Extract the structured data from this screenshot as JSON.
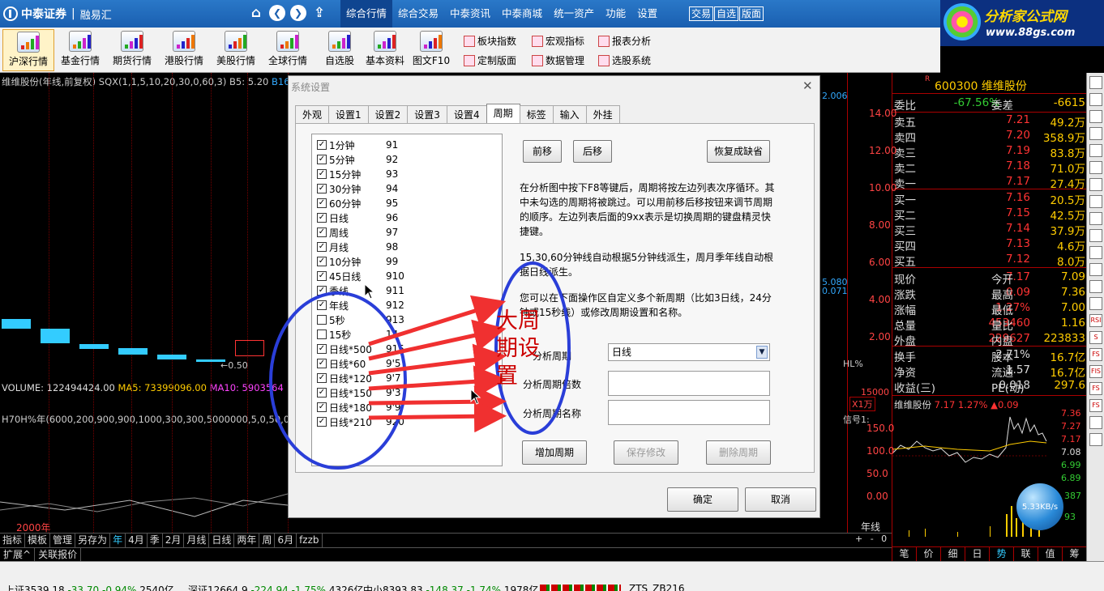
{
  "topbar": {
    "logo": "中泰证券",
    "sub": "融易汇",
    "nav_icons": [
      "home-icon",
      "back-icon",
      "forward-icon",
      "upload-icon"
    ],
    "menu": [
      "综合行情",
      "综合交易",
      "中泰资讯",
      "中泰商城",
      "统一资产",
      "功能",
      "设置"
    ],
    "active_menu": "综合行情",
    "quick": [
      "交易",
      "自选",
      "版面"
    ]
  },
  "brand": {
    "title": "分析家公式网",
    "url": "www.88gs.com"
  },
  "toolbar": {
    "buttons": [
      "沪深行情",
      "基金行情",
      "期货行情",
      "港股行情",
      "美股行情",
      "全球行情",
      "自选股",
      "基本资料",
      "图文F10"
    ],
    "links": [
      "板块指数",
      "宏观指标",
      "报表分析",
      "定制版面",
      "数据管理",
      "选股系统"
    ]
  },
  "chart": {
    "title": "维维股份(年线,前复权) SQX(1,1,5,10,20,30,0,60,3) B5: 5.20",
    "title_tail": "B16",
    "price_axis": [
      "14.00",
      "12.00",
      "10.00",
      "8.00",
      "6.00",
      "4.00",
      "2.00"
    ],
    "volume_line": {
      "vol": "VOLUME: 122494424.00",
      "ma5": "MA5: 73399096.00",
      "ma10": "MA10: 5903564"
    },
    "indicator_line": "H70H%年(6000,200,900,900,1000,300,300,5000000,5,0,50,0,1",
    "indicator_axis": [
      "150.0",
      "100.0",
      "50.0",
      "0.00"
    ],
    "marker_050": "←0.50",
    "year": "2000年",
    "hl": "HL%",
    "x1w": "X1万",
    "v15000": "15000",
    "v5080": "5.080",
    "v0071": "0.071",
    "v2006": "2.006",
    "xinhao": "信号1:"
  },
  "period_tabs": [
    "指标",
    "模板",
    "管理",
    "另存为",
    "年",
    "4月",
    "季",
    "2月",
    "月线",
    "日线",
    "两年",
    "周",
    "6月",
    "fzzb"
  ],
  "period_sel": "年",
  "year_label": "年线",
  "zoom": "+ - 0",
  "ext_tabs": [
    "扩展^",
    "关联报价"
  ],
  "status": {
    "sh": {
      "name": "上证",
      "val": "3539.18",
      "chg": "-33.70",
      "pct": "-0.94%",
      "amt": "2540亿"
    },
    "sz": {
      "name": "深证",
      "val": "12664.9",
      "chg": "-224.94",
      "pct": "-1.75%",
      "amt": "4326亿"
    },
    "zx": {
      "name": "中小",
      "val": "8393.83",
      "chg": "-148.37",
      "pct": "-1.74%",
      "amt": "1978亿"
    },
    "ext": "ZTS_ZB216"
  },
  "quote": {
    "r": "R",
    "code": "600300 维维股份",
    "weibi_label": "委比",
    "weibi": "-67.56%",
    "weicha_label": "委差",
    "weicha": "-6615",
    "sells": [
      {
        "label": "卖五",
        "price": "7.21",
        "vol": "49.2万"
      },
      {
        "label": "卖四",
        "price": "7.20",
        "vol": "358.9万"
      },
      {
        "label": "卖三",
        "price": "7.19",
        "vol": "83.8万"
      },
      {
        "label": "卖二",
        "price": "7.18",
        "vol": "71.0万"
      },
      {
        "label": "卖一",
        "price": "7.17",
        "vol": "27.4万"
      }
    ],
    "buys": [
      {
        "label": "买一",
        "price": "7.16",
        "vol": "20.5万"
      },
      {
        "label": "买二",
        "price": "7.15",
        "vol": "42.5万"
      },
      {
        "label": "买三",
        "price": "7.14",
        "vol": "37.9万"
      },
      {
        "label": "买四",
        "price": "7.13",
        "vol": "4.6万"
      },
      {
        "label": "买五",
        "price": "7.12",
        "vol": "8.0万"
      }
    ],
    "stats": [
      {
        "l1": "现价",
        "v1": "7.17",
        "l2": "今开",
        "v2": "7.09"
      },
      {
        "l1": "涨跌",
        "v1": "0.09",
        "l2": "最高",
        "v2": "7.36"
      },
      {
        "l1": "涨幅",
        "v1": "1.27%",
        "l2": "最低",
        "v2": "7.00"
      },
      {
        "l1": "总量",
        "v1": "453460",
        "l2": "量比",
        "v2": "1.16"
      },
      {
        "l1": "外盘",
        "v1": "229627",
        "l2": "内盘",
        "v2": "223833"
      }
    ],
    "stats2": [
      {
        "l1": "换手",
        "v1": "2.71%",
        "l2": "股本",
        "v2": "16.7亿"
      },
      {
        "l1": "净资",
        "v1": "1.57",
        "l2": "流通",
        "v2": "16.7亿"
      },
      {
        "l1": "收益(三)",
        "v1": "0.018",
        "l2": "PE(动)",
        "v2": "297.6"
      }
    ],
    "mini_title": "维维股份",
    "mini_price": "7.17",
    "mini_pct": "1.27%",
    "mini_chg": "▲0.09",
    "mini_axis": [
      "7.36",
      "7.27",
      "7.17",
      "7.08",
      "6.99",
      "6.89"
    ],
    "mini_pcts": [
      "387",
      "93"
    ],
    "speed": "5.33KB/s",
    "tabs": [
      "笔",
      "价",
      "细",
      "日",
      "势",
      "联",
      "值",
      "筹"
    ],
    "tab_sel": "势"
  },
  "side_icons": [
    "RSI",
    "S",
    "FS",
    "FIS",
    "FS",
    "FS"
  ],
  "dialog": {
    "title": "系统设置",
    "tabs": [
      "外观",
      "设置1",
      "设置2",
      "设置3",
      "设置4",
      "周期",
      "标签",
      "输入",
      "外挂"
    ],
    "tab_sel": "周期",
    "periods": [
      {
        "name": "1分钟",
        "code": "91",
        "checked": true
      },
      {
        "name": "5分钟",
        "code": "92",
        "checked": true
      },
      {
        "name": "15分钟",
        "code": "93",
        "checked": true
      },
      {
        "name": "30分钟",
        "code": "94",
        "checked": true
      },
      {
        "name": "60分钟",
        "code": "95",
        "checked": true
      },
      {
        "name": "日线",
        "code": "96",
        "checked": true
      },
      {
        "name": "周线",
        "code": "97",
        "checked": true
      },
      {
        "name": "月线",
        "code": "98",
        "checked": true
      },
      {
        "name": "10分钟",
        "code": "99",
        "checked": true
      },
      {
        "name": "45日线",
        "code": "910",
        "checked": true
      },
      {
        "name": "季线",
        "code": "911",
        "checked": true
      },
      {
        "name": "年线",
        "code": "912",
        "checked": true
      },
      {
        "name": "5秒",
        "code": "913",
        "checked": false
      },
      {
        "name": "15秒",
        "code": "14",
        "checked": false
      },
      {
        "name": "日线*500",
        "code": "915",
        "checked": true
      },
      {
        "name": "日线*60",
        "code": "9'5",
        "checked": true
      },
      {
        "name": "日线*120",
        "code": "9'7",
        "checked": true
      },
      {
        "name": "日线*150",
        "code": "9'3",
        "checked": true
      },
      {
        "name": "日线*180",
        "code": "9'9",
        "checked": true
      },
      {
        "name": "日线*210",
        "code": "920",
        "checked": true
      }
    ],
    "btn_prev": "前移",
    "btn_next": "后移",
    "btn_restore": "恢复成缺省",
    "desc1": "在分析图中按下F8等键后，周期将按左边列表次序循环。其中未勾选的周期将被跳过。可以用前移后移按钮来调节周期的顺序。左边列表后面的9xx表示是切换周期的键盘精灵快捷键。",
    "desc2": "15,30,60分钟线自动根据5分钟线派生，周月季年线自动根据日线派生。",
    "desc3": "您可以在下面操作区自定义多个新周期（比如3日线，24分钟或15秒线）或修改周期设置和名称。",
    "f_base": "分析周期",
    "f_base_val": "日线",
    "f_mult": "分析周期倍数",
    "f_name": "分析周期名称",
    "btn_add": "增加周期",
    "btn_save": "保存修改",
    "btn_del": "删除周期",
    "btn_ok": "确定",
    "btn_cancel": "取消"
  },
  "annotation": {
    "text": "大周期设置"
  }
}
